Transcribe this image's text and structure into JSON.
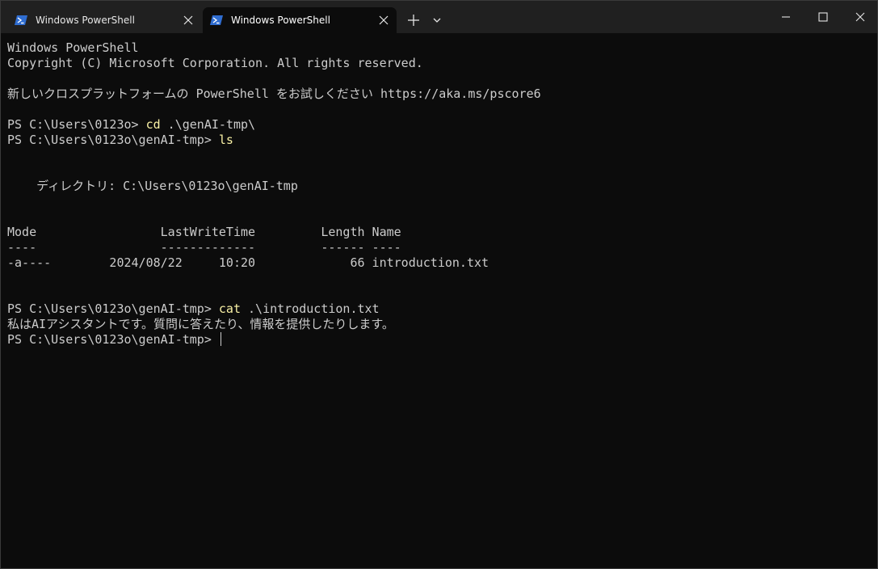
{
  "tabs": [
    {
      "label": "Windows PowerShell",
      "icon": "powershell-icon",
      "active": false
    },
    {
      "label": "Windows PowerShell",
      "icon": "powershell-icon",
      "active": true
    }
  ],
  "titlebar_icons": {
    "new_tab": "plus-icon",
    "dropdown": "chevron-down-icon",
    "minimize": "minimize-icon",
    "maximize": "maximize-icon",
    "close": "close-icon"
  },
  "terminal": {
    "banner_line1": "Windows PowerShell",
    "banner_line2": "Copyright (C) Microsoft Corporation. All rights reserved.",
    "banner_line3": "新しいクロスプラットフォームの PowerShell をお試しください https://aka.ms/pscore6",
    "prompt1": "PS C:\\Users\\0123o> ",
    "command1": "cd",
    "command1_args": " .\\genAI-tmp\\",
    "prompt2": "PS C:\\Users\\0123o\\genAI-tmp> ",
    "command2": "ls",
    "directory_label": "    ディレクトリ: C:\\Users\\0123o\\genAI-tmp",
    "columns_header": "Mode                 LastWriteTime         Length Name",
    "columns_underline": "----                 -------------         ------ ----",
    "file_row": "-a----        2024/08/22     10:20             66 introduction.txt",
    "prompt3": "PS C:\\Users\\0123o\\genAI-tmp> ",
    "command3": "cat",
    "command3_args": " .\\introduction.txt",
    "file_content": "私はAIアシスタントです。質問に答えたり、情報を提供したりします。",
    "prompt4": "PS C:\\Users\\0123o\\genAI-tmp> "
  },
  "colors": {
    "background": "#0c0c0c",
    "titlebar": "#202020",
    "text": "#cccccc",
    "command": "#f9f1a5",
    "powershell_blue": "#2f6dd1"
  }
}
